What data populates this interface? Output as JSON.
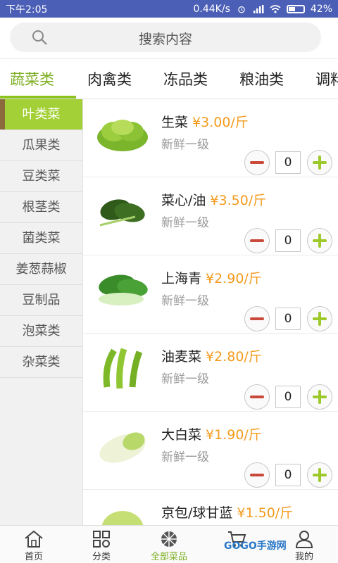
{
  "status_bar": {
    "time": "下午2:05",
    "network_speed": "0.44K/s",
    "battery": "42%"
  },
  "search": {
    "placeholder": "搜索内容"
  },
  "tabs": [
    {
      "label": "蔬菜类",
      "active": true
    },
    {
      "label": "肉禽类",
      "active": false
    },
    {
      "label": "冻品类",
      "active": false
    },
    {
      "label": "粮油类",
      "active": false
    },
    {
      "label": "调料",
      "active": false
    }
  ],
  "sidebar": {
    "items": [
      {
        "label": "叶类菜",
        "active": true
      },
      {
        "label": "瓜果类",
        "active": false
      },
      {
        "label": "豆类菜",
        "active": false
      },
      {
        "label": "根茎类",
        "active": false
      },
      {
        "label": "菌类菜",
        "active": false
      },
      {
        "label": "姜葱蒜椒",
        "active": false
      },
      {
        "label": "豆制品",
        "active": false
      },
      {
        "label": "泡菜类",
        "active": false
      },
      {
        "label": "杂菜类",
        "active": false
      }
    ]
  },
  "products": [
    {
      "name": "生菜",
      "price": "¥3.00/斤",
      "grade": "新鲜一级",
      "qty": "0",
      "image": "lettuce-image"
    },
    {
      "name": "菜心/油",
      "price": "¥3.50/斤",
      "grade": "新鲜一级",
      "qty": "0",
      "image": "choy-sum-image"
    },
    {
      "name": "上海青",
      "price": "¥2.90/斤",
      "grade": "新鲜一级",
      "qty": "0",
      "image": "bok-choy-image"
    },
    {
      "name": "油麦菜",
      "price": "¥2.80/斤",
      "grade": "新鲜一级",
      "qty": "0",
      "image": "a-choy-image"
    },
    {
      "name": "大白菜",
      "price": "¥1.90/斤",
      "grade": "新鲜一级",
      "qty": "0",
      "image": "napa-cabbage-image"
    },
    {
      "name": "京包/球甘蓝",
      "price": "¥1.50/斤",
      "grade": "",
      "qty": "",
      "image": "cabbage-image"
    }
  ],
  "bottom_nav": [
    {
      "label": "首页",
      "icon": "home-icon"
    },
    {
      "label": "分类",
      "icon": "category-icon"
    },
    {
      "label": "全部菜品",
      "icon": "all-dishes-icon",
      "active": true
    },
    {
      "label": "",
      "icon": "cart-icon"
    },
    {
      "label": "我的",
      "icon": "user-icon"
    }
  ],
  "watermark": "GOGO手游网",
  "colors": {
    "status_bar": "#4a5fb5",
    "accent_green": "#8dc21f",
    "price_orange": "#f39b1d",
    "minus_red": "#c9493a",
    "sidebar_bg": "#f1f1f1"
  }
}
